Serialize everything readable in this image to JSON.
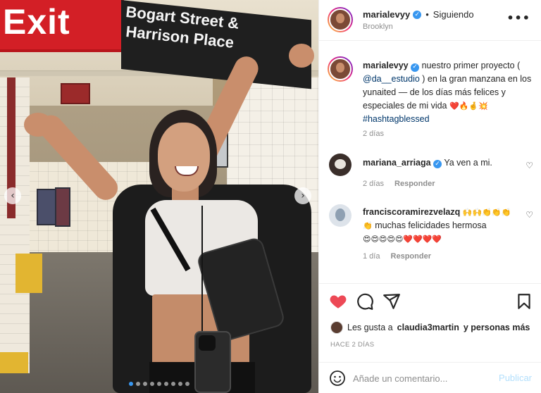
{
  "photo": {
    "sign_exit": "Exit",
    "sign_street_line1": "Bogart Street &",
    "sign_street_line2": "Harrison Place",
    "carousel": {
      "prev_icon": "chevron-left-icon",
      "next_icon": "chevron-right-icon",
      "dot_count": 9,
      "active_dot": 0
    }
  },
  "header": {
    "username": "marialevyy",
    "follow_label": "Siguiendo",
    "location": "Brooklyn",
    "more_label": "•••"
  },
  "caption": {
    "username": "marialevyy",
    "text_before": "nuestro primer proyecto (",
    "mention": "@da__estudio",
    "text_after": ") en la gran manzana en los yunaited — de los días más felices y especiales de mi vida",
    "emojis": "❤️🔥🤞💥",
    "hashtag": "#hashtagblessed",
    "time": "2 días"
  },
  "comments": [
    {
      "username": "mariana_arriaga",
      "verified": true,
      "text": "Ya ven a mi.",
      "time": "2 días",
      "reply_label": "Responder"
    },
    {
      "username": "franciscoramirezvelazq",
      "verified": false,
      "emojis_before": "🙌🙌👏👏👏👏",
      "text": "muchas felicidades hermosa",
      "emojis_after": "😍😍😍😍😍❤️❤️❤️❤️",
      "time": "1 día",
      "reply_label": "Responder"
    }
  ],
  "likes": {
    "text_prefix": "Les gusta a",
    "user": "claudia3martin",
    "text_suffix": "y personas más"
  },
  "timestamp": "HACE 2 DÍAS",
  "comment_box": {
    "placeholder": "Añade un comentario...",
    "publish_label": "Publicar"
  },
  "colors": {
    "like_red": "#ed4956",
    "link_blue": "#00376b",
    "publish_disabled": "#b2dffc",
    "verified_blue": "#3897f0"
  }
}
